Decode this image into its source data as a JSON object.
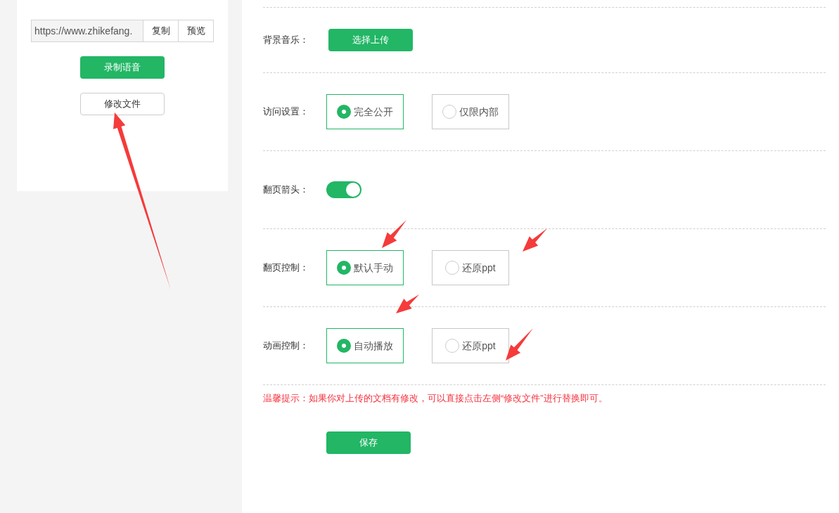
{
  "link_card": {
    "url": "https://www.zhikefang.",
    "copy_button": "复制",
    "preview_button": "预览",
    "record_button": "录制语音",
    "modify_button": "修改文件"
  },
  "settings": [
    {
      "kind": "upload",
      "label": "背景音乐：",
      "button": "选择上传"
    },
    {
      "kind": "radio",
      "label": "访问设置：",
      "options": [
        {
          "label": "完全公开",
          "selected": true
        },
        {
          "label": "仅限内部",
          "selected": false
        }
      ]
    },
    {
      "kind": "toggle",
      "label": "翻页箭头：",
      "on": true
    },
    {
      "kind": "radio",
      "label": "翻页控制：",
      "options": [
        {
          "label": "默认手动",
          "selected": true
        },
        {
          "label": "还原ppt",
          "selected": false
        }
      ]
    },
    {
      "kind": "radio",
      "label": "动画控制：",
      "options": [
        {
          "label": "自动播放",
          "selected": true
        },
        {
          "label": "还原ppt",
          "selected": false
        }
      ]
    }
  ],
  "tip": "温馨提示：如果你对上传的文档有修改，可以直接点击左侧“修改文件”进行替换即可。",
  "save_button": "保存"
}
